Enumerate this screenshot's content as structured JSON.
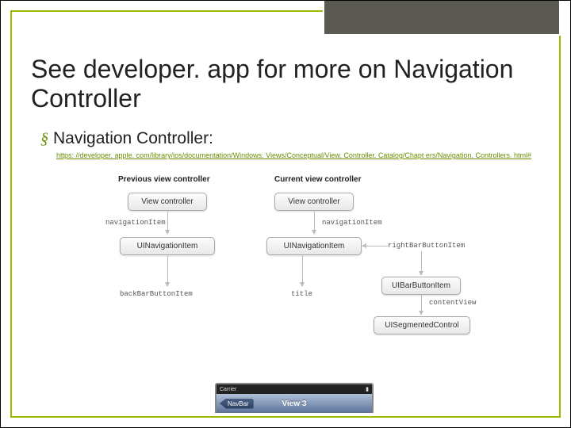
{
  "title": "See developer. app for more on Navigation Controller",
  "bullet": {
    "icon": "§",
    "text": "Navigation Controller:"
  },
  "link": "https: //developer. apple. com/library/ios/documentation/Windows. Views/Conceptual/View. Controller. Catalog/Chapt ers/Navigation. Controllers. html#",
  "diagram": {
    "headers": {
      "prev": "Previous view controller",
      "curr": "Current view controller"
    },
    "nodes": {
      "prev_vc": "View controller",
      "curr_vc": "View controller",
      "prev_nav": "UINavigationItem",
      "curr_nav": "UINavigationItem",
      "barbtn": "UIBarButtonItem",
      "segmented": "UISegmentedControl"
    },
    "labels": {
      "navItemL": "navigationItem",
      "navItemR": "navigationItem",
      "backBar": "backBarButtonItem",
      "title": "title",
      "rightBar": "rightBarButtonItem",
      "contentView": "contentView"
    }
  },
  "phone": {
    "carrier": "Carrier",
    "back": "NavBar",
    "title": "View 3"
  }
}
